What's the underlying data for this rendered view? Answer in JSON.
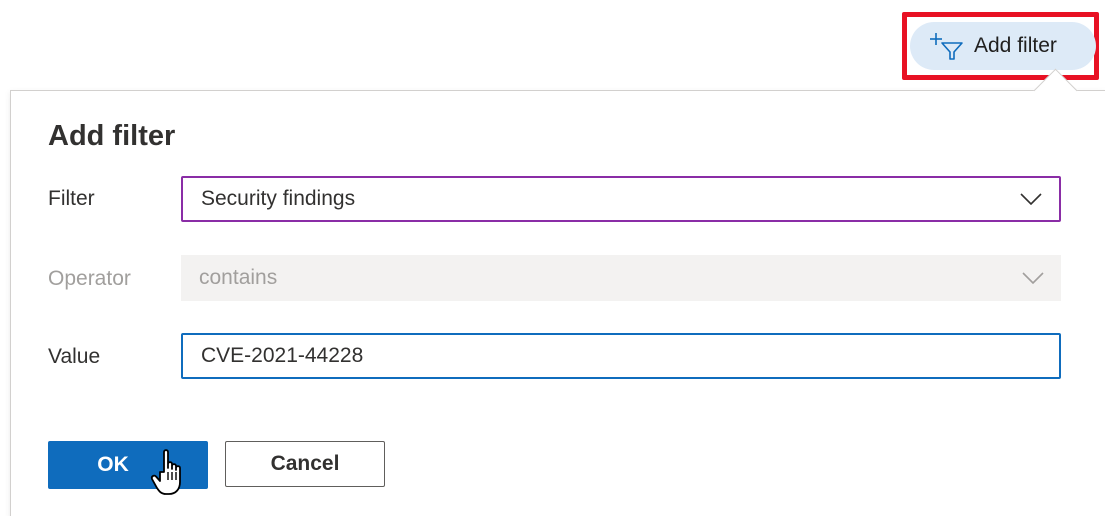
{
  "toolbar": {
    "add_filter_label": "Add filter"
  },
  "dialog": {
    "title": "Add filter",
    "filter": {
      "label": "Filter",
      "value": "Security findings"
    },
    "operator": {
      "label": "Operator",
      "value": "contains"
    },
    "value_field": {
      "label": "Value",
      "value": "CVE-2021-44228"
    },
    "ok_label": "OK",
    "cancel_label": "Cancel"
  },
  "colors": {
    "primary": "#0f6cbd",
    "highlight": "#e81123",
    "filter_focus": "#8a2da6",
    "pill_bg": "#ddeaf7"
  },
  "icons": {
    "add_filter": "add-filter-funnel-icon",
    "dropdown": "chevron-down-icon",
    "cursor": "hand-pointer-icon"
  }
}
